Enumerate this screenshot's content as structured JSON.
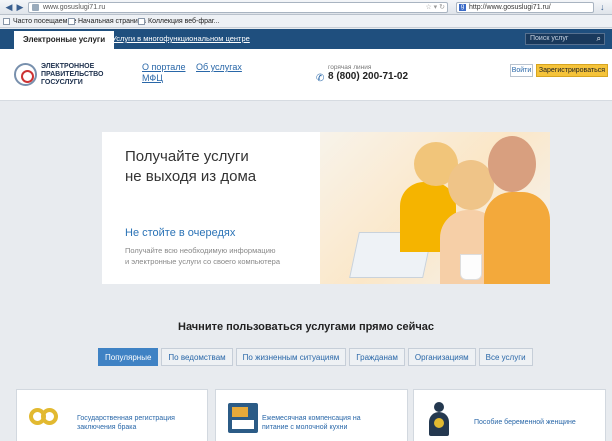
{
  "browser": {
    "url": "www.gosuslugi71.ru",
    "search_value": "http://www.gosuslugi71.ru/",
    "bookmarks": [
      {
        "label": "Часто посещаемые"
      },
      {
        "label": "Начальная страница"
      },
      {
        "label": "Коллекция веб-фраг..."
      }
    ]
  },
  "sitebar": {
    "active_tab": "Электронные услуги",
    "mfc_link": "Услуги в многофункциональном центре",
    "search_placeholder": "Поиск услуг"
  },
  "header": {
    "logo_lines": [
      "ЭЛЕКТРОННОЕ",
      "ПРАВИТЕЛЬСТВО",
      "ГОСУСЛУГИ"
    ],
    "links": [
      "О портале",
      "МФЦ",
      "Об услугах"
    ],
    "hotline_label": "горячая линия",
    "phone": "8 (800) 200-71-02",
    "login_label": "Войти",
    "register_label": "Зарегистрироваться"
  },
  "hero": {
    "title_line1": "Получайте услуги",
    "title_line2": "не выходя из дома",
    "subtitle": "Не стойте в очередях",
    "text_line1": "Получайте всю необходимую информацию",
    "text_line2": "и электронные услуги со своего компьютера"
  },
  "services": {
    "title": "Начните пользоваться услугами прямо сейчас",
    "tabs": [
      "Популярные",
      "По ведомствам",
      "По жизненным ситуациям",
      "Гражданам",
      "Организациям",
      "Все услуги"
    ],
    "cards": [
      {
        "line1": "Государственная регистрация",
        "line2": "заключения брака",
        "icon": "rings-icon"
      },
      {
        "line1": "Ежемесячная компенсация на",
        "line2": "питание с молочной кухни",
        "icon": "calendar-icon"
      },
      {
        "line1": "Пособие беременной женщине",
        "line2": "",
        "icon": "pregnant-woman-icon"
      }
    ]
  },
  "colors": {
    "site_header": "#1f4f7e",
    "link": "#2967a8",
    "register": "#f5c33a",
    "active_tab": "#3f82c4"
  }
}
